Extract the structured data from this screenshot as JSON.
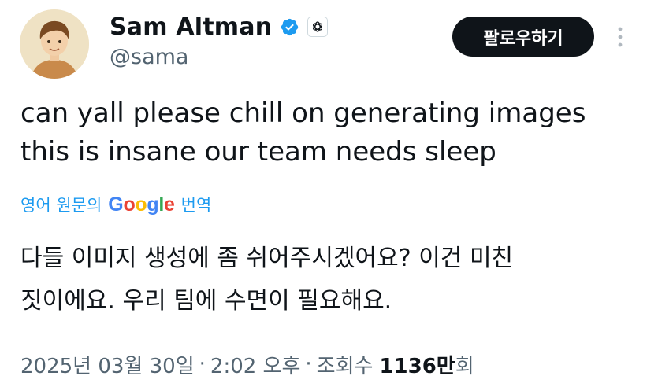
{
  "profile": {
    "display_name": "Sam Altman",
    "handle": "@sama",
    "verified_icon": "verified-badge-icon",
    "affiliation_icon": "openai-logo-icon"
  },
  "actions": {
    "follow_label": "팔로우하기",
    "more_icon": "more-vertical-icon"
  },
  "tweet": {
    "text": "can yall please chill on generating images\nthis is insane our team needs sleep"
  },
  "translation": {
    "prefix": "영어 원문의",
    "google": "Google",
    "suffix": "번역",
    "text": "다들 이미지 생성에 좀 쉬어주시겠어요? 이건 미친\n짓이에요. 우리 팀에 수면이 필요해요."
  },
  "meta": {
    "date": "2025년 03월 30일",
    "sep1": "·",
    "time": "2:02 오후",
    "sep2": "·",
    "views_label": "조회수",
    "views_count": "1136만",
    "views_suffix": "회"
  },
  "colors": {
    "accent": "#1d9bf0",
    "text": "#0f1419",
    "muted": "#536471",
    "button_bg": "#0f1419"
  }
}
